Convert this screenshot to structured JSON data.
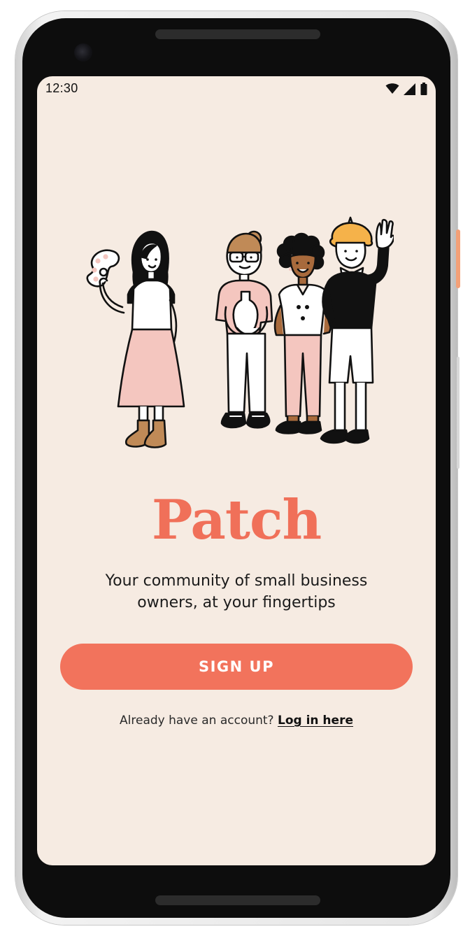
{
  "status_bar": {
    "time": "12:30",
    "icons": [
      "wifi-icon",
      "cell-signal-icon",
      "battery-icon"
    ]
  },
  "hero": {
    "illustration": "four-small-business-owners-illustration"
  },
  "brand": {
    "name": "Patch",
    "color": "#f07059"
  },
  "tagline": {
    "line1": "Your community of small business",
    "line2": "owners, at your fingertips"
  },
  "actions": {
    "signup_label": "SIGN UP",
    "signup_color": "#f2735c",
    "login_prompt": "Already have an account? ",
    "login_link": "Log in here"
  },
  "colors": {
    "background": "#f6ebe2",
    "accent": "#f2735c",
    "pink": "#f4c6bf",
    "skin_tan": "#c08a57",
    "hair_yellow": "#f5b24a"
  }
}
